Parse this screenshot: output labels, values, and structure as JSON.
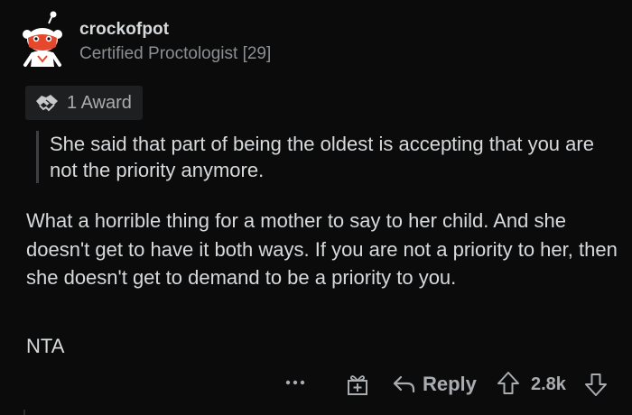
{
  "comment": {
    "author": "crockofpot",
    "flair": "Certified Proctologist [29]",
    "award": {
      "icon": "handshake-award-icon",
      "label": "1 Award"
    },
    "quote": "She said that part of being the oldest is accepting that you are not the priority anymore.",
    "body": "What a horrible thing for a mother to say to her child. And she doesn't get to have it both ways. If you are not a priority to her, then she doesn't get to demand to be a priority to you.",
    "verdict": "NTA"
  },
  "actions": {
    "more_icon": "more-dots-icon",
    "gift_icon": "gift-award-icon",
    "reply_label": "Reply",
    "score": "2.8k"
  },
  "colors": {
    "background": "#0b0b0b",
    "text": "#d7dadc",
    "muted": "#8b8f93",
    "action": "#a9adb1",
    "avatar_accent": "#e5482c"
  }
}
